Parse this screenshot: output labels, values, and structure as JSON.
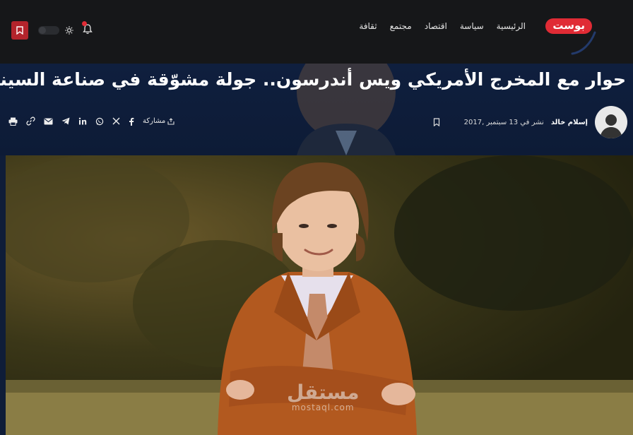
{
  "brand": {
    "logo_text": "بوست",
    "accent": "#e02b35"
  },
  "nav": {
    "items": [
      {
        "label": "الرئيسية"
      },
      {
        "label": "سياسة"
      },
      {
        "label": "اقتصاد"
      },
      {
        "label": "مجتمع"
      },
      {
        "label": "ثقافة"
      }
    ]
  },
  "tools": {
    "bookmark_icon": "bookmark-icon",
    "theme_icon": "sun-icon",
    "notification_icon": "bell-icon"
  },
  "article": {
    "title": "حوار مع المخرج الأمريكي ويس أندرسون.. جولة مشوّقة في صناعة السينما",
    "author": "إسلام خالد",
    "date": "نشر في 13 سبتمبر ,2017",
    "share_label": "مشاركة",
    "share_icons": [
      "facebook-icon",
      "x-icon",
      "whatsapp-icon",
      "linkedin-icon",
      "telegram-icon",
      "email-icon",
      "link-icon",
      "print-icon"
    ]
  },
  "watermark": {
    "arabic": "مستقل",
    "latin": "mostaql.com"
  }
}
